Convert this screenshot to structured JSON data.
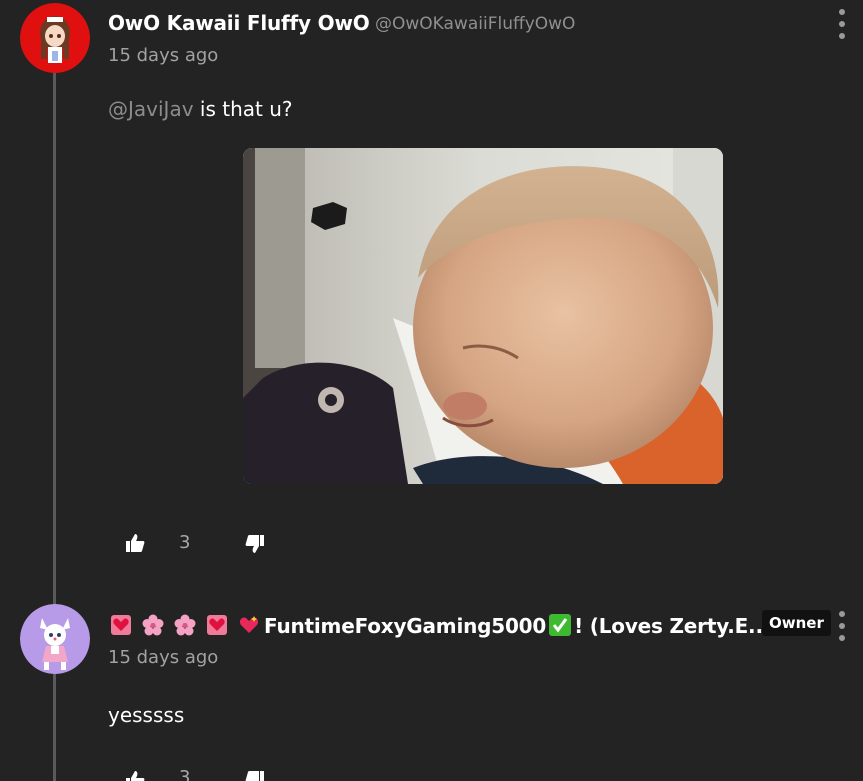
{
  "comments": [
    {
      "display_name": "OwO Kawaii Fluffy OwO",
      "handle": "@OwOKawaiiFluffyOwO",
      "timestamp": "15 days ago",
      "mention": "@JaviJav",
      "text": " is that u?",
      "avatar_bg": "#e01010",
      "upvotes": "3"
    },
    {
      "display_name_text": "FuntimeFoxyGaming5000",
      "display_name_suffix": "! (Loves Zerty.E...",
      "badge": "Owner",
      "timestamp": "15 days ago",
      "text": "yesssss",
      "avatar_bg": "#b79be8",
      "upvotes": "3"
    }
  ],
  "icons": {
    "like": "thumbs-up-icon",
    "dislike": "thumbs-down-icon",
    "menu": "kebab-menu-icon"
  },
  "colors": {
    "background": "#232323",
    "thread_line": "#5a5a5a",
    "muted_text": "#a2a2a2"
  }
}
